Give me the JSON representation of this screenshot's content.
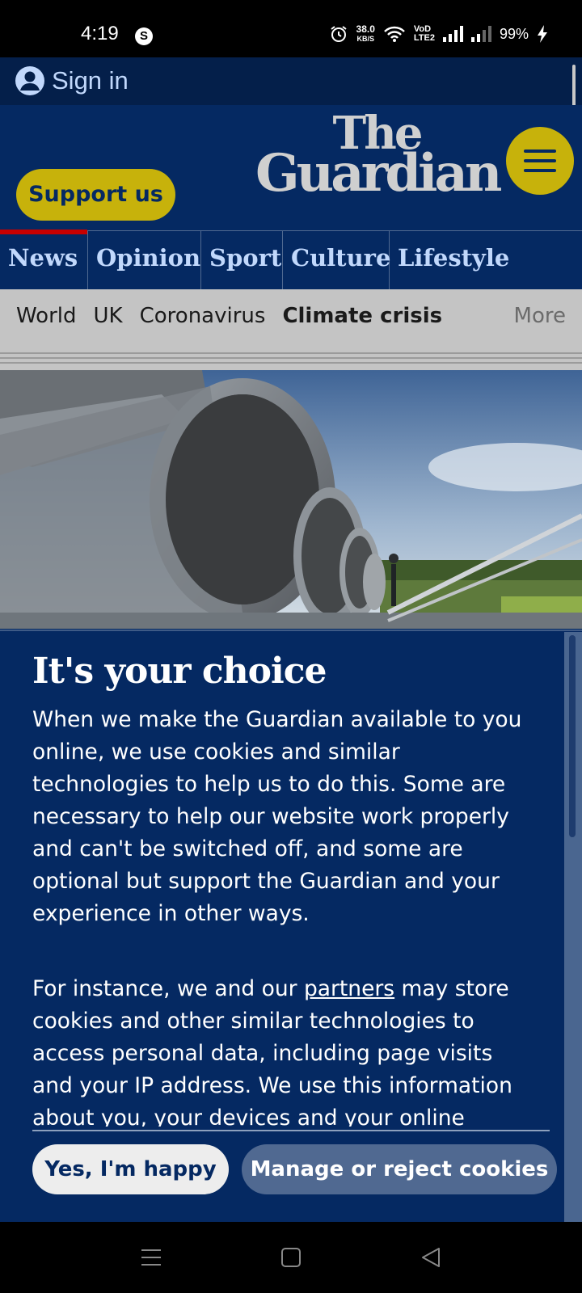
{
  "status_bar": {
    "time": "4:19",
    "app_icon": "S",
    "net_speed_value": "38.0",
    "net_speed_unit": "KB/S",
    "volte_top": "VoD",
    "volte_bottom": "LTE2",
    "battery": "99%"
  },
  "topbar": {
    "sign_in": "Sign in"
  },
  "header": {
    "support_label": "Support us",
    "logo_line1": "The",
    "logo_line2": "Guardian"
  },
  "pillars": [
    "News",
    "Opinion",
    "Sport",
    "Culture",
    "Lifestyle"
  ],
  "subnav": {
    "items": [
      "World",
      "UK",
      "Coronavirus",
      "Climate crisis"
    ],
    "more": "More"
  },
  "consent": {
    "title": "It's your choice",
    "p1": "When we make the Guardian available to you online, we use cookies and similar technologies to help us to do this. Some are necessary to help our website work properly and can't be switched off, and some are optional but support the Guardian and your experience in other ways.",
    "p2_before": "For instance, we and our ",
    "p2_link": "partners",
    "p2_after": " may store cookies and other similar technologies to access personal data, including page visits and your IP address. We use this information about you, your devices and your online",
    "accept_label": "Yes, I'm happy",
    "manage_label": "Manage or reject cookies"
  },
  "colors": {
    "brand_blue": "#052962",
    "accent_yellow": "#c7b20b",
    "news_red": "#c70000"
  }
}
